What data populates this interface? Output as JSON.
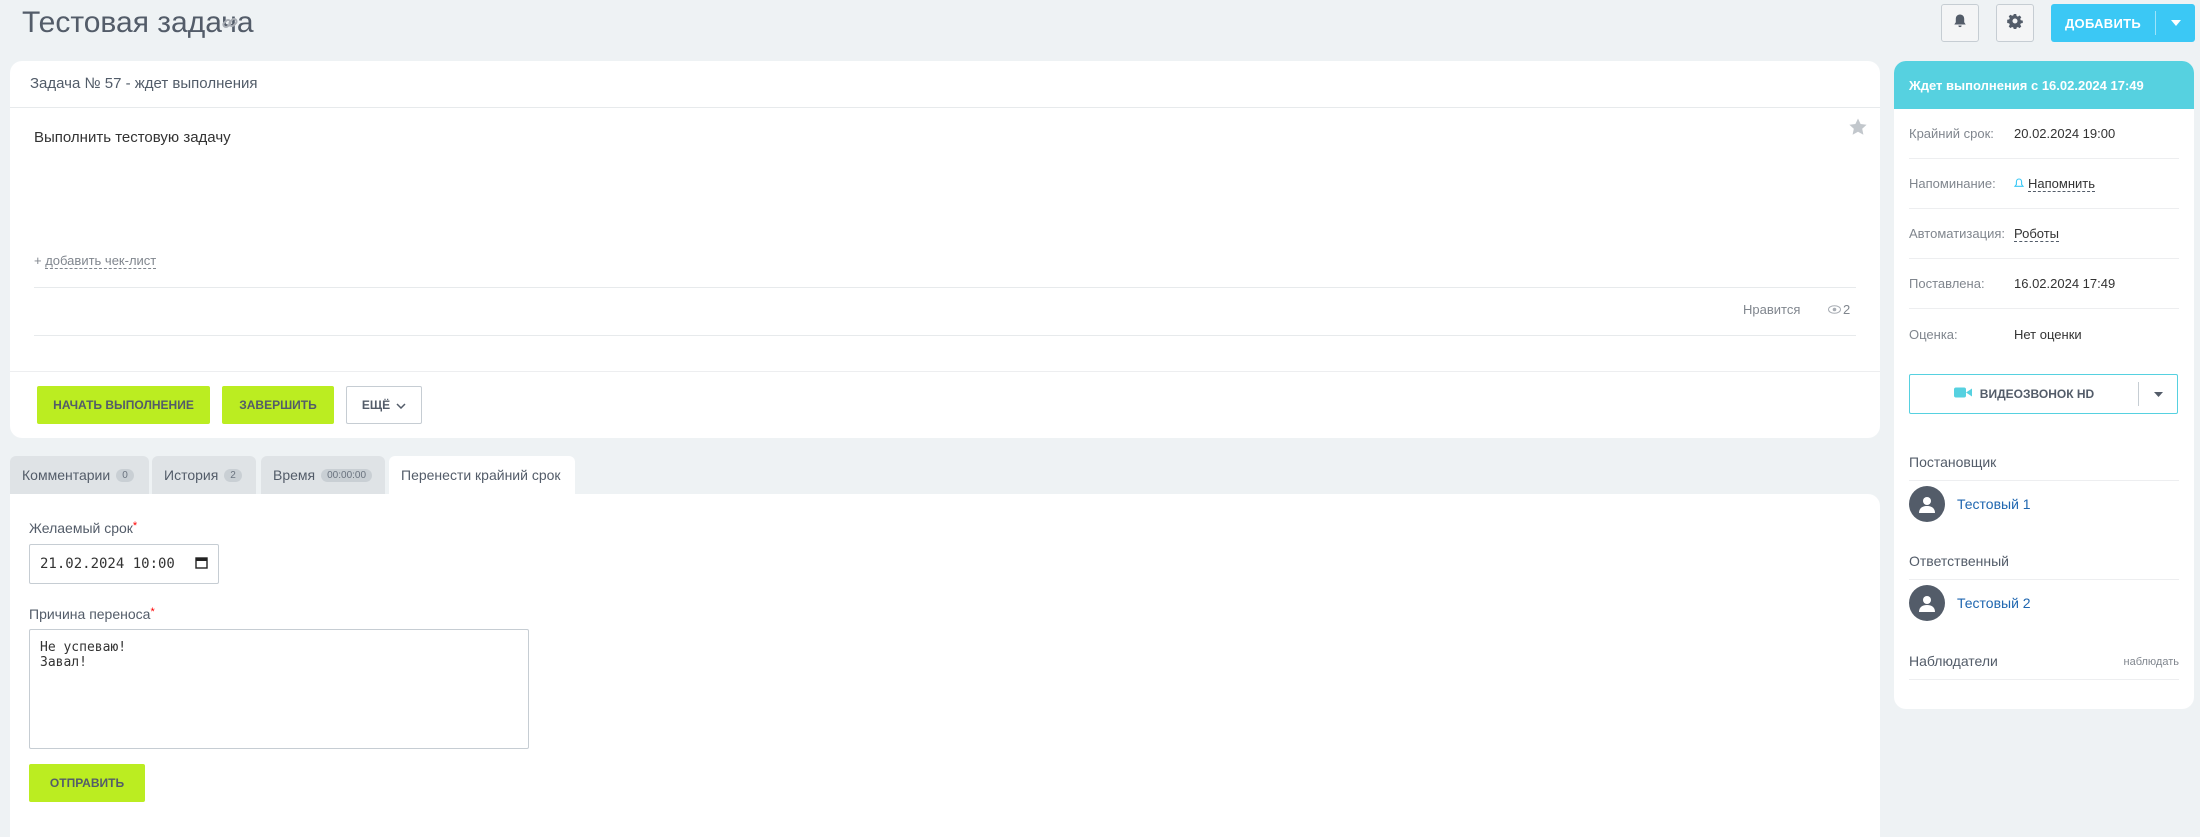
{
  "header": {
    "title": "Тестовая задача",
    "add_label": "ДОБАВИТЬ"
  },
  "task": {
    "head": "Задача № 57 - ждет выполнения",
    "description": "Выполнить тестовую задачу",
    "add_checklist_prefix": "+ ",
    "add_checklist": "добавить чек-лист",
    "likes": "Нравится",
    "views": "2",
    "start_label": "НАЧАТЬ ВЫПОЛНЕНИЕ",
    "finish_label": "ЗАВЕРШИТЬ",
    "more_label": "ЕЩЁ"
  },
  "tabs": [
    {
      "label": "Комментарии",
      "count": "0"
    },
    {
      "label": "История",
      "count": "2"
    },
    {
      "label": "Время",
      "count": "00:00:00"
    },
    {
      "label": "Перенести крайний срок"
    }
  ],
  "deadline_form": {
    "date_label": "Желаемый срок",
    "date_value": "21.02.2024 10:00",
    "reason_label": "Причина переноса",
    "reason_value": "Не успеваю!\nЗавал!",
    "submit_label": "ОТПРАВИТЬ"
  },
  "sidebar": {
    "status": "Ждет выполнения с 16.02.2024 17:49",
    "rows": [
      {
        "key": "Крайний срок:",
        "value": "20.02.2024 19:00"
      },
      {
        "key": "Напоминание:",
        "value": "Напомнить"
      },
      {
        "key": "Автоматизация:",
        "value": "Роботы"
      },
      {
        "key": "Поставлена:",
        "value": "16.02.2024 17:49"
      },
      {
        "key": "Оценка:",
        "value": "Нет оценки"
      }
    ],
    "video_label": "ВИДЕОЗВОНОК HD",
    "creator_title": "Постановщик",
    "creator_name": "Тестовый 1",
    "responsible_title": "Ответственный",
    "responsible_name": "Тестовый 2",
    "watchers_title": "Наблюдатели",
    "watchers_link": "наблюдать"
  },
  "colors": {
    "accent_blue": "#3bc8f5",
    "status_teal": "#56d1e0",
    "action_green": "#bbed21",
    "link_blue": "#2067b0"
  }
}
